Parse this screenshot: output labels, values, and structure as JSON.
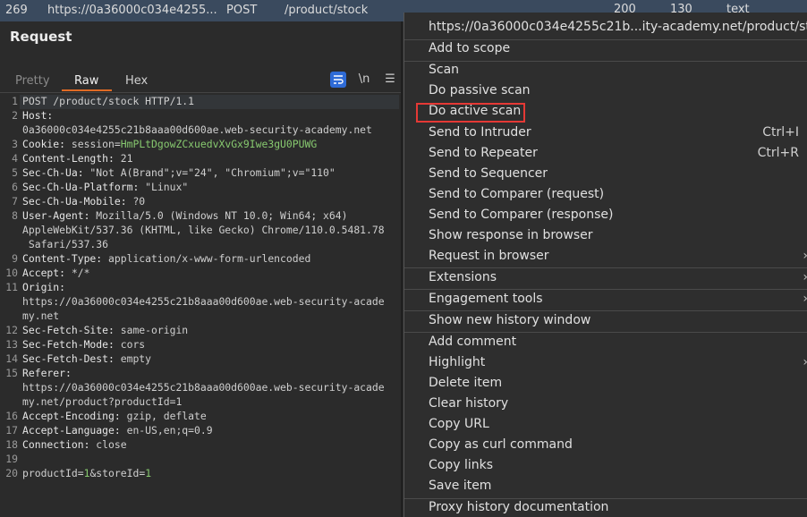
{
  "top_row": {
    "number": "269",
    "url": "https://0a36000c034e4255...",
    "method": "POST",
    "path": "/product/stock",
    "status": "200",
    "length": "130",
    "mime": "text"
  },
  "request_panel": {
    "title": "Request",
    "tabs": [
      "Pretty",
      "Raw",
      "Hex"
    ],
    "active_tab": "Raw",
    "newline_label": "\\n"
  },
  "code_lines": [
    {
      "n": "1",
      "text": "POST /product/stock HTTP/1.1"
    },
    {
      "n": "2",
      "text": "Host:"
    },
    {
      "n": "",
      "text": "0a36000c034e4255c21b8aaa00d600ae.web-security-academy.net"
    },
    {
      "n": "3",
      "text": "Cookie: session=HmPLtDgowZCxuedvXvGx9Iwe3gU0PUWG"
    },
    {
      "n": "4",
      "text": "Content-Length: 21"
    },
    {
      "n": "5",
      "text": "Sec-Ch-Ua: \"Not A(Brand\";v=\"24\", \"Chromium\";v=\"110\""
    },
    {
      "n": "6",
      "text": "Sec-Ch-Ua-Platform: \"Linux\""
    },
    {
      "n": "7",
      "text": "Sec-Ch-Ua-Mobile: ?0"
    },
    {
      "n": "8",
      "text": "User-Agent: Mozilla/5.0 (Windows NT 10.0; Win64; x64)"
    },
    {
      "n": "",
      "text": "AppleWebKit/537.36 (KHTML, like Gecko) Chrome/110.0.5481.78"
    },
    {
      "n": "",
      "text": " Safari/537.36"
    },
    {
      "n": "9",
      "text": "Content-Type: application/x-www-form-urlencoded"
    },
    {
      "n": "10",
      "text": "Accept: */*"
    },
    {
      "n": "11",
      "text": "Origin:"
    },
    {
      "n": "",
      "text": "https://0a36000c034e4255c21b8aaa00d600ae.web-security-acade"
    },
    {
      "n": "",
      "text": "my.net"
    },
    {
      "n": "12",
      "text": "Sec-Fetch-Site: same-origin"
    },
    {
      "n": "13",
      "text": "Sec-Fetch-Mode: cors"
    },
    {
      "n": "14",
      "text": "Sec-Fetch-Dest: empty"
    },
    {
      "n": "15",
      "text": "Referer:"
    },
    {
      "n": "",
      "text": "https://0a36000c034e4255c21b8aaa00d600ae.web-security-acade"
    },
    {
      "n": "",
      "text": "my.net/product?productId=1"
    },
    {
      "n": "16",
      "text": "Accept-Encoding: gzip, deflate"
    },
    {
      "n": "17",
      "text": "Accept-Language: en-US,en;q=0.9"
    },
    {
      "n": "18",
      "text": "Connection: close"
    },
    {
      "n": "19",
      "text": ""
    },
    {
      "n": "20",
      "text": "productId=1&storeId=1"
    }
  ],
  "context_menu": {
    "header": "https://0a36000c034e4255c21b...ity-academy.net/product/stock",
    "items": [
      {
        "label": "Add to scope"
      },
      {
        "label": "Scan"
      },
      {
        "label": "Do passive scan"
      },
      {
        "label": "Do active scan"
      },
      {
        "label": "Send to Intruder",
        "shortcut": "Ctrl+I"
      },
      {
        "label": "Send to Repeater",
        "shortcut": "Ctrl+R"
      },
      {
        "label": "Send to Sequencer"
      },
      {
        "label": "Send to Comparer (request)"
      },
      {
        "label": "Send to Comparer (response)"
      },
      {
        "label": "Show response in browser"
      },
      {
        "label": "Request in browser"
      },
      {
        "label": "Extensions"
      },
      {
        "label": "Engagement tools"
      },
      {
        "label": "Show new history window"
      },
      {
        "label": "Add comment"
      },
      {
        "label": "Highlight"
      },
      {
        "label": "Delete item"
      },
      {
        "label": "Clear history"
      },
      {
        "label": "Copy URL"
      },
      {
        "label": "Copy as curl command"
      },
      {
        "label": "Copy links"
      },
      {
        "label": "Save item"
      },
      {
        "label": "Proxy history documentation"
      }
    ]
  },
  "colors": {
    "highlight_box": "#e53935",
    "active_tab": "#e06b25",
    "background": "#2b2b2b"
  }
}
